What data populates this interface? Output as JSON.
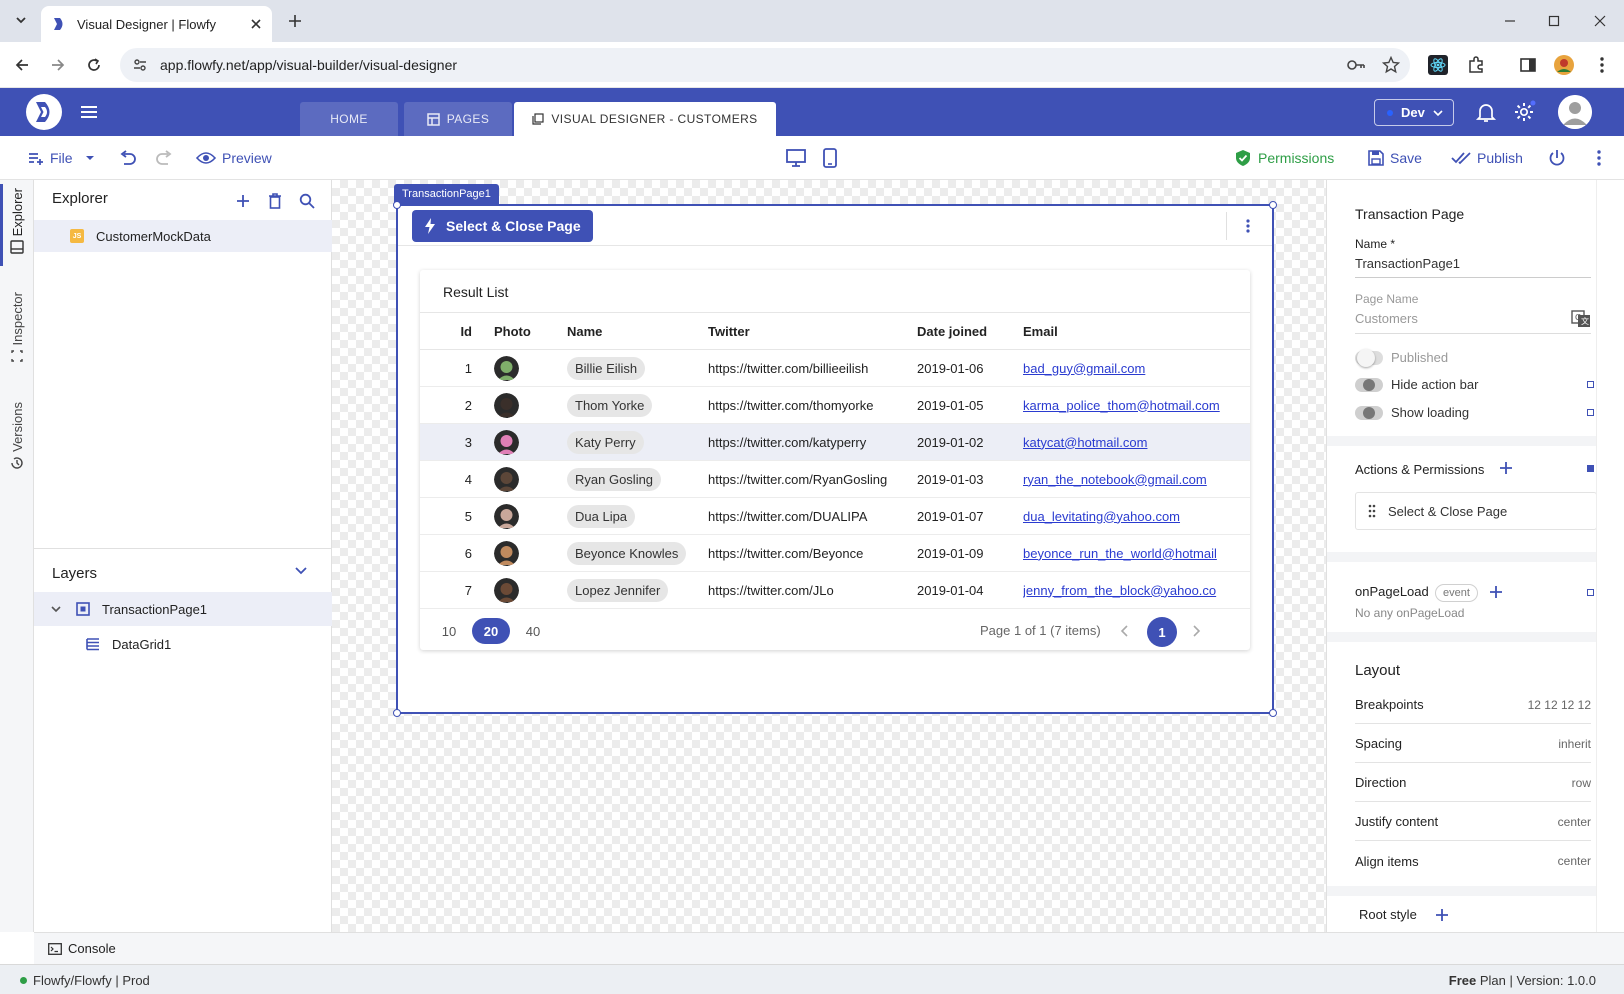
{
  "browser": {
    "tab_title": "Visual Designer | Flowfy",
    "url": "app.flowfy.net/app/visual-builder/visual-designer"
  },
  "app": {
    "tabs": [
      {
        "label": "HOME"
      },
      {
        "label": "PAGES"
      },
      {
        "label": "VISUAL DESIGNER - CUSTOMERS"
      }
    ],
    "env": "Dev"
  },
  "toolbar": {
    "file": "File",
    "preview": "Preview",
    "permissions": "Permissions",
    "save": "Save",
    "publish": "Publish"
  },
  "rail": {
    "explorer": "Explorer",
    "inspector": "Inspector",
    "versions": "Versions"
  },
  "explorer": {
    "title": "Explorer",
    "items": [
      {
        "label": "CustomerMockData",
        "badge": "JS"
      }
    ]
  },
  "layers": {
    "title": "Layers",
    "root": "TransactionPage1",
    "child": "DataGrid1"
  },
  "canvas": {
    "page_label": "TransactionPage1",
    "action_button": "Select & Close Page",
    "grid": {
      "title": "Result List",
      "columns": [
        "Id",
        "Photo",
        "Name",
        "Twitter",
        "Date joined",
        "Email"
      ],
      "rows": [
        {
          "id": "1",
          "name": "Billie Eilish",
          "twitter": "https://twitter.com/billieeilish",
          "date": "2019-01-06",
          "email": "bad_guy@gmail.com",
          "photo_color": "#7fae6a"
        },
        {
          "id": "2",
          "name": "Thom Yorke",
          "twitter": "https://twitter.com/thomyorke",
          "date": "2019-01-05",
          "email": "karma_police_thom@hotmail.com",
          "photo_color": "#3a2f2a"
        },
        {
          "id": "3",
          "name": "Katy Perry",
          "twitter": "https://twitter.com/katyperry",
          "date": "2019-01-02",
          "email": "katycat@hotmail.com",
          "photo_color": "#e07fb6"
        },
        {
          "id": "4",
          "name": "Ryan Gosling",
          "twitter": "https://twitter.com/RyanGosling",
          "date": "2019-01-03",
          "email": "ryan_the_notebook@gmail.com",
          "photo_color": "#5c4638"
        },
        {
          "id": "5",
          "name": "Dua Lipa",
          "twitter": "https://twitter.com/DUALIPA",
          "date": "2019-01-07",
          "email": "dua_levitating@yahoo.com",
          "photo_color": "#c9a79a"
        },
        {
          "id": "6",
          "name": "Beyonce Knowles",
          "twitter": "https://twitter.com/Beyonce",
          "date": "2019-01-09",
          "email": "beyonce_run_the_world@hotmail",
          "photo_color": "#c08a5e"
        },
        {
          "id": "7",
          "name": "Lopez Jennifer",
          "twitter": "https://twitter.com/JLo",
          "date": "2019-01-04",
          "email": "jenny_from_the_block@yahoo.co",
          "photo_color": "#6b4a36"
        }
      ],
      "selected_row": 3,
      "page_sizes": [
        "10",
        "20",
        "40"
      ],
      "active_page_size": "20",
      "page_info": "Page 1 of 1 (7 items)",
      "current_page": "1"
    }
  },
  "props": {
    "title": "Transaction Page",
    "name_label": "Name *",
    "name_value": "TransactionPage1",
    "page_name_label": "Page Name",
    "page_name_value": "Customers",
    "toggles": [
      {
        "label": "Published",
        "on": false,
        "disabled": true
      },
      {
        "label": "Hide action bar",
        "on": false,
        "disabled": false
      },
      {
        "label": "Show loading",
        "on": false,
        "disabled": false
      }
    ],
    "actions_title": "Actions & Permissions",
    "action_item": "Select & Close Page",
    "onpageload": "onPageLoad",
    "event_chip": "event",
    "onpageload_empty": "No any onPageLoad",
    "layout_title": "Layout",
    "layout": [
      {
        "k": "Breakpoints",
        "v": "12 12 12 12"
      },
      {
        "k": "Spacing",
        "v": "inherit"
      },
      {
        "k": "Direction",
        "v": "row"
      },
      {
        "k": "Justify content",
        "v": "center"
      },
      {
        "k": "Align items",
        "v": "center"
      }
    ],
    "root_style": "Root style"
  },
  "console": "Console",
  "status": {
    "left": "Flowfy/Flowfy | Prod",
    "plan_bold": "Free",
    "plan_rest": " Plan | Version: 1.0.0"
  },
  "colors": {
    "primary": "#3f51b5",
    "link": "#2a3bd0",
    "success": "#2e9e46"
  }
}
